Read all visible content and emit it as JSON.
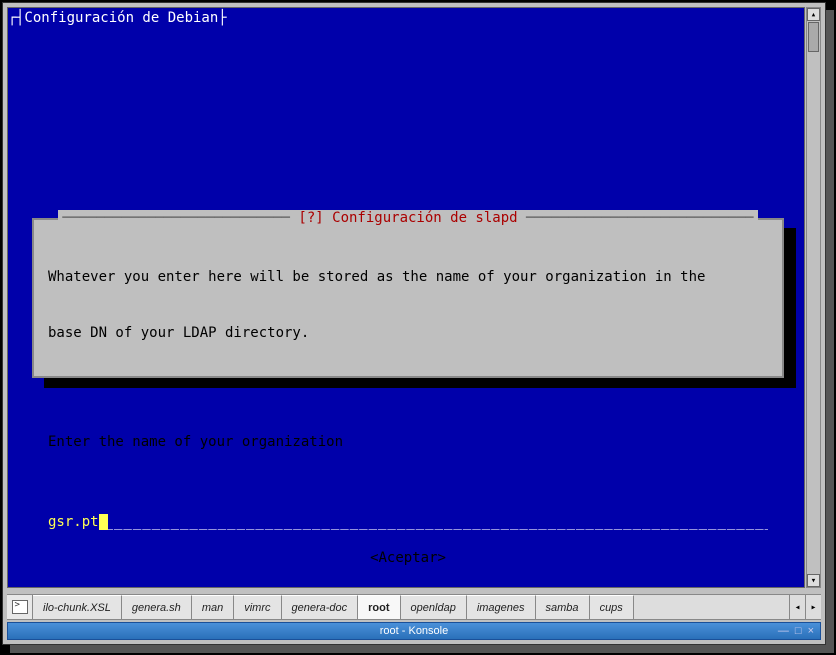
{
  "terminal": {
    "title_corner": "┌",
    "title": "┤Configuración de Debian├",
    "dialog": {
      "title_prefix": "[?] ",
      "title": "Configuración de slapd",
      "body_line1": "Whatever you enter here will be stored as the name of your organization in the",
      "body_line2": "base DN of your LDAP directory.",
      "body_prompt": "Enter the name of your organization",
      "input_value": "gsr.pt",
      "accept_label": "<Aceptar>"
    }
  },
  "tabs": {
    "items": [
      "ilo-chunk.XSL",
      "genera.sh",
      "man",
      "vimrc",
      "genera-doc",
      "root",
      "openldap",
      "imagenes",
      "samba",
      "cups"
    ],
    "active_index": 5
  },
  "status": {
    "text": "root - Konsole",
    "min": "—",
    "max": "□",
    "close": "×"
  },
  "scroll": {
    "up": "▴",
    "down": "▾",
    "left": "◂",
    "right": "▸"
  }
}
